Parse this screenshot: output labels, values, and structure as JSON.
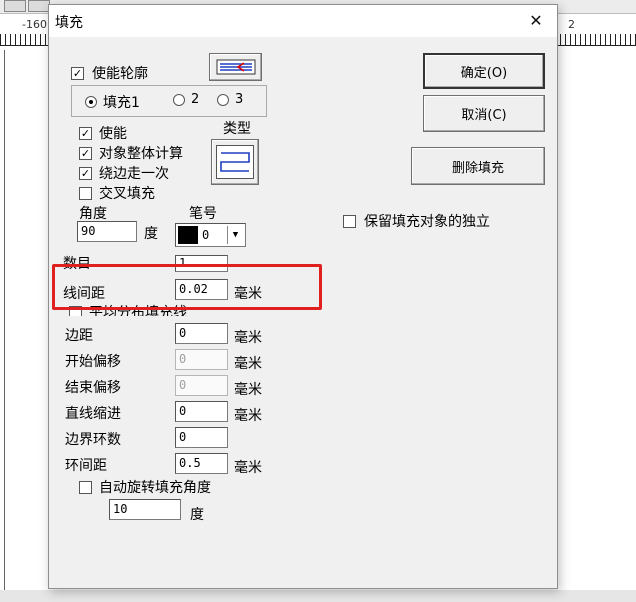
{
  "ruler": {
    "left_num": "-160",
    "right_num": "2"
  },
  "dialog": {
    "title": "填充",
    "close_glyph": "✕",
    "enable_outline": {
      "label": "使能轮廓",
      "checked": true
    },
    "fill_radios": [
      {
        "label": "填充1",
        "selected": true
      },
      {
        "label": "2",
        "selected": false
      },
      {
        "label": "3",
        "selected": false
      }
    ],
    "fill_options": [
      {
        "label": "使能",
        "checked": true
      },
      {
        "label": "对象整体计算",
        "checked": true
      },
      {
        "label": "绕边走一次",
        "checked": true
      },
      {
        "label": "交叉填充",
        "checked": false
      }
    ],
    "type_label": "类型",
    "angle": {
      "label": "角度",
      "value": "90",
      "unit": "度"
    },
    "pen": {
      "label": "笔号",
      "value": "0",
      "color": "#000000"
    },
    "count": {
      "label": "数目",
      "value": "1"
    },
    "line_spacing": {
      "label": "线间距",
      "value": "0.02",
      "unit": "毫米"
    },
    "even_distribute": {
      "label": "平均分布填充线",
      "checked": false
    },
    "fields": [
      {
        "label": "边距",
        "value": "0",
        "unit": "毫米",
        "disabled": false
      },
      {
        "label": "开始偏移",
        "value": "0",
        "unit": "毫米",
        "disabled": true
      },
      {
        "label": "结束偏移",
        "value": "0",
        "unit": "毫米",
        "disabled": true
      },
      {
        "label": "直线缩进",
        "value": "0",
        "unit": "毫米",
        "disabled": false
      },
      {
        "label": "边界环数",
        "value": "0",
        "unit": "",
        "disabled": false
      },
      {
        "label": "环间距",
        "value": "0.5",
        "unit": "毫米",
        "disabled": false
      }
    ],
    "auto_rotate": {
      "label": "自动旋转填充角度",
      "checked": false,
      "value": "10",
      "unit": "度"
    },
    "buttons": {
      "ok": "确定(O)",
      "cancel": "取消(C)",
      "delete": "删除填充"
    },
    "keep_independent": {
      "label": "保留填充对象的独立",
      "checked": false
    },
    "highlight_color": "#e01f1f"
  }
}
